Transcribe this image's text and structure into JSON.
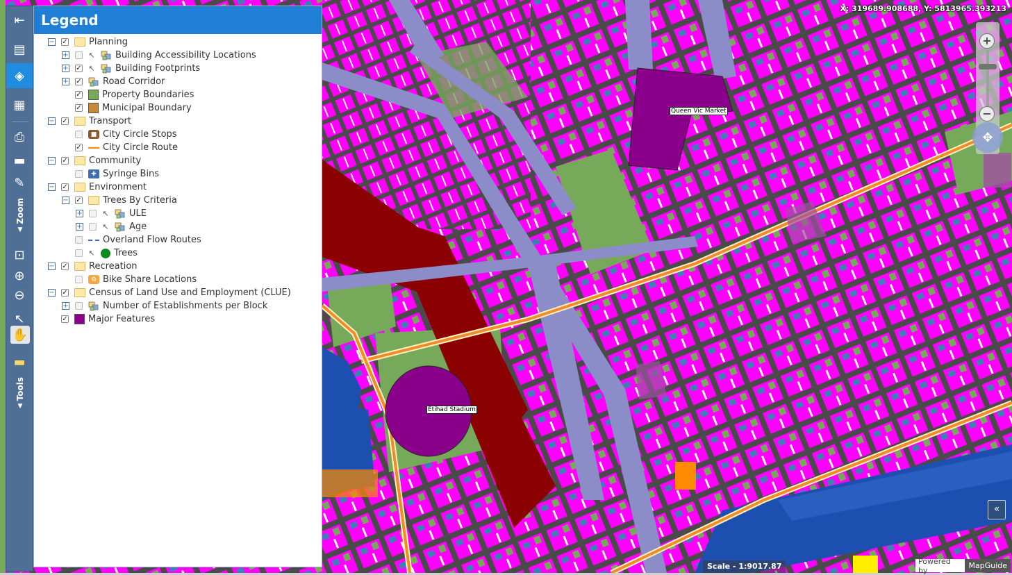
{
  "legend": {
    "title": "Legend",
    "items": [
      {
        "label": "Planning",
        "level": 0,
        "expand": "minus",
        "checked": true,
        "icon": "folder-icon"
      },
      {
        "label": "Building Accessibility Locations",
        "level": 1,
        "expand": "plus",
        "checked": false,
        "selectable": true,
        "icon": "layers-icon"
      },
      {
        "label": "Building Footprints",
        "level": 1,
        "expand": "plus",
        "checked": true,
        "selectable": true,
        "icon": "layers-icon"
      },
      {
        "label": "Road Corridor",
        "level": 1,
        "expand": "plus",
        "checked": true,
        "icon": "layers-icon"
      },
      {
        "label": "Property Boundaries",
        "level": 1,
        "expand": "none",
        "checked": true,
        "icon": "swatch-icon",
        "color": "#77a95a"
      },
      {
        "label": "Municipal Boundary",
        "level": 1,
        "expand": "none",
        "checked": true,
        "icon": "swatch-icon",
        "color": "#c8883a"
      },
      {
        "label": "Transport",
        "level": 0,
        "expand": "minus",
        "checked": true,
        "icon": "folder-icon"
      },
      {
        "label": "City Circle Stops",
        "level": 1,
        "expand": "none",
        "checked": false,
        "icon": "tram-stop-icon"
      },
      {
        "label": "City Circle Route",
        "level": 1,
        "expand": "none",
        "checked": true,
        "icon": "route-line-icon"
      },
      {
        "label": "Community",
        "level": 0,
        "expand": "minus",
        "checked": true,
        "icon": "folder-icon"
      },
      {
        "label": "Syringe Bins",
        "level": 1,
        "expand": "none",
        "checked": false,
        "icon": "syringe-bin-icon"
      },
      {
        "label": "Environment",
        "level": 0,
        "expand": "minus",
        "checked": true,
        "icon": "folder-icon"
      },
      {
        "label": "Trees By Criteria",
        "level": 1,
        "expand": "minus",
        "checked": true,
        "icon": "folder-icon"
      },
      {
        "label": "ULE",
        "level": 2,
        "expand": "plus",
        "checked": false,
        "selectable": true,
        "icon": "layers-icon"
      },
      {
        "label": "Age",
        "level": 2,
        "expand": "plus",
        "checked": false,
        "selectable": true,
        "icon": "layers-icon"
      },
      {
        "label": "Overland Flow Routes",
        "level": 1,
        "expand": "none",
        "checked": false,
        "icon": "dashed-line-icon"
      },
      {
        "label": "Trees",
        "level": 1,
        "expand": "none",
        "checked": false,
        "selectable": true,
        "icon": "tree-circle-icon"
      },
      {
        "label": "Recreation",
        "level": 0,
        "expand": "minus",
        "checked": true,
        "icon": "folder-icon"
      },
      {
        "label": "Bike Share Locations",
        "level": 1,
        "expand": "none",
        "checked": false,
        "icon": "bike-share-icon"
      },
      {
        "label": "Census of Land Use and Employment (CLUE)",
        "level": 0,
        "expand": "minus",
        "checked": true,
        "icon": "folder-icon"
      },
      {
        "label": "Number of Establishments per Block",
        "level": 1,
        "expand": "plus",
        "checked": false,
        "icon": "layers-icon"
      },
      {
        "label": "Major Features",
        "level": 0,
        "expand": "none",
        "checked": true,
        "icon": "swatch-icon",
        "color": "#8b008b"
      }
    ]
  },
  "toolbar": {
    "zoom_label": "Zoom",
    "tools_label": "Tools"
  },
  "map": {
    "coordinates": "X: 319689.908688, Y: 5813965.393213",
    "scale": "Scale - 1:9017.87",
    "powered_by": "Powered by",
    "brand": "MapGuide",
    "labels": {
      "queen_vic": "Queen Vic Market",
      "etihad": "Etihad Stadium"
    },
    "colors": {
      "buildings": "#ff00ff",
      "roads": "#4a4a4a",
      "parks": "#77a95a",
      "rail": "#8b0000",
      "water": "#1d4fb0",
      "major_features": "#8b008b",
      "route": "#f18a2a"
    }
  }
}
